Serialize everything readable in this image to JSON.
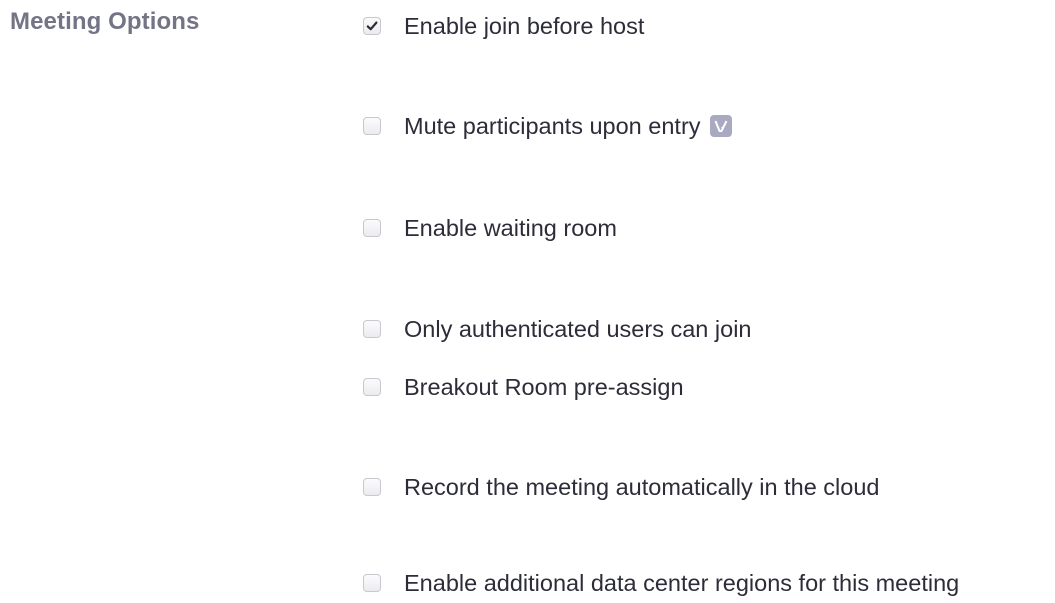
{
  "section_label": "Meeting Options",
  "colors": {
    "section_label": "#747487",
    "option_text": "#2d2d3a",
    "badge_bg": "#a9a9c2"
  },
  "options": [
    {
      "label": "Enable join before host",
      "checked": true,
      "badge_icon": null
    },
    {
      "label": "Mute participants upon entry",
      "checked": false,
      "badge_icon": "info-badge-icon"
    },
    {
      "label": "Enable waiting room",
      "checked": false,
      "badge_icon": null
    },
    {
      "label": "Only authenticated users can join",
      "checked": false,
      "badge_icon": null
    },
    {
      "label": "Breakout Room pre-assign",
      "checked": false,
      "badge_icon": null
    },
    {
      "label": "Record the meeting automatically in the cloud",
      "checked": false,
      "badge_icon": null
    },
    {
      "label": "Enable additional data center regions for this meeting",
      "checked": false,
      "badge_icon": null
    }
  ]
}
